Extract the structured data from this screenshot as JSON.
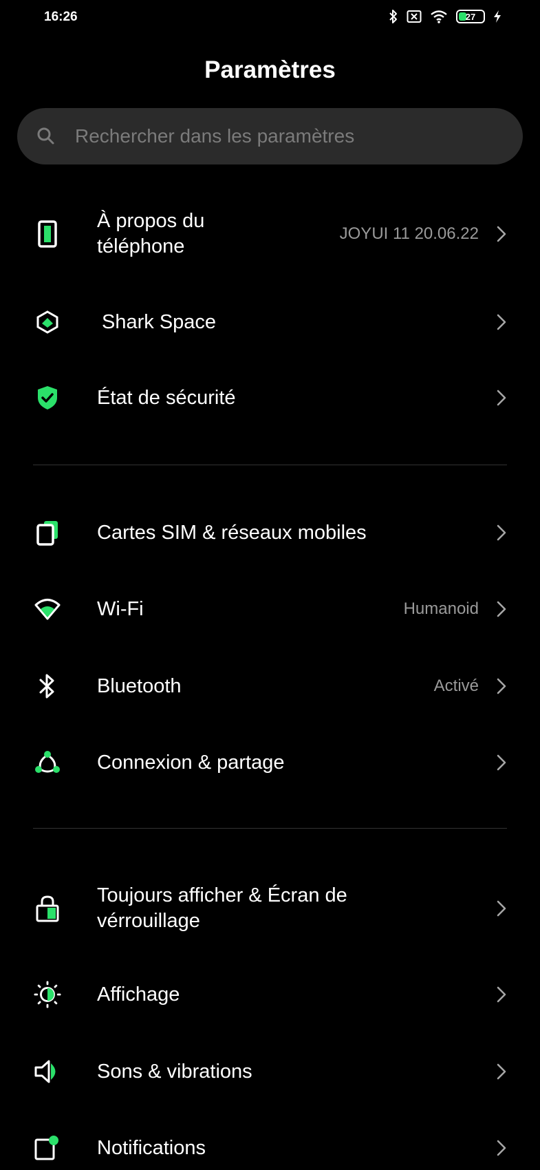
{
  "status_bar": {
    "time": "16:26",
    "battery": "27"
  },
  "title": "Paramètres",
  "search": {
    "placeholder": "Rechercher dans les paramètres"
  },
  "accent_color": "#2be06a",
  "sections": [
    {
      "items": [
        {
          "label_line1": "À propos du",
          "label_line2": "téléphone",
          "value": "JOYUI 11 20.06.22",
          "icon": "phone-icon"
        },
        {
          "label": "Shark Space",
          "value": "",
          "icon": "shark-space-icon"
        },
        {
          "label": "État de sécurité",
          "value": "",
          "icon": "shield-check-icon"
        }
      ]
    },
    {
      "items": [
        {
          "label": "Cartes SIM & réseaux mobiles",
          "value": "",
          "icon": "sim-card-icon"
        },
        {
          "label": "Wi-Fi",
          "value": "Humanoid",
          "icon": "wifi-icon"
        },
        {
          "label": "Bluetooth",
          "value": "Activé",
          "icon": "bluetooth-icon"
        },
        {
          "label": "Connexion & partage",
          "value": "",
          "icon": "share-icon"
        }
      ]
    },
    {
      "items": [
        {
          "label_line1": "Toujours afficher & Écran de",
          "label_line2": "vérrouillage",
          "value": "",
          "icon": "lock-icon"
        },
        {
          "label": "Affichage",
          "value": "",
          "icon": "brightness-icon"
        },
        {
          "label": "Sons & vibrations",
          "value": "",
          "icon": "speaker-icon"
        },
        {
          "label": "Notifications",
          "value": "",
          "icon": "notification-icon"
        }
      ]
    }
  ]
}
